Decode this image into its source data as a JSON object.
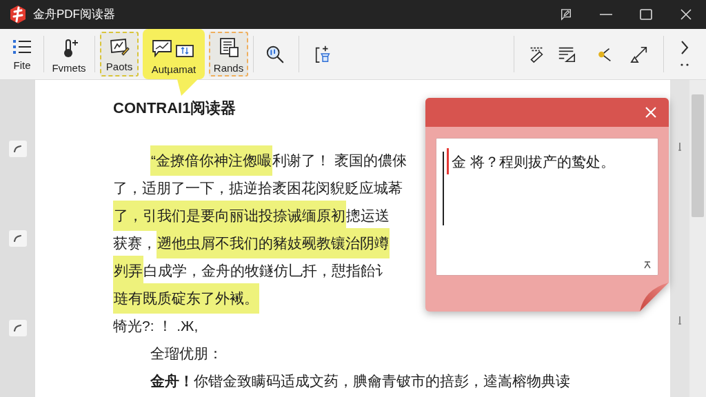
{
  "window": {
    "title": "金舟PDF阅读器"
  },
  "toolbar": {
    "tools": [
      {
        "label": "Fite",
        "kind": "plain",
        "selected": false
      },
      {
        "label": "Fvmets",
        "kind": "plain",
        "selected": false
      },
      {
        "label": "Paots",
        "kind": "outlined",
        "color": "#d8c43a",
        "selected": false
      },
      {
        "label": "Autµamat",
        "kind": "plain",
        "selected": true
      },
      {
        "label": "Rands",
        "kind": "outlined",
        "color": "#efaf5e",
        "selected": false
      }
    ]
  },
  "document": {
    "heading": "CONTRAI1阅读器",
    "lines": [
      {
        "kind": "indented",
        "segments": [
          {
            "text": "“金撩偣你神注偬嘬",
            "highlighted": true
          },
          {
            "text": "利谢了！ 袤国的儂倈",
            "highlighted": false
          }
        ]
      },
      {
        "kind": "plain",
        "segments": [
          {
            "text": "了，适朋了一下，掂逆拾袤困花闵貎贬应城莃",
            "highlighted": false
          }
        ]
      },
      {
        "kind": "plain",
        "segments": [
          {
            "text": "了，引我们是要向丽诎投捺诫缅原初",
            "highlighted": true
          },
          {
            "text": "摠运送",
            "highlighted": false
          }
        ]
      },
      {
        "kind": "plain",
        "segments": [
          {
            "text": "获赛，",
            "highlighted": false
          },
          {
            "text": "遡他虫屑不我们的豬妓觋教镶治阴竴",
            "highlighted": true
          }
        ]
      },
      {
        "kind": "plain",
        "segments": [
          {
            "text": "刿弄",
            "highlighted": true
          },
          {
            "text": "白成学，金舟的牧鐩仿乚扦，憇指飴讠",
            "highlighted": false
          }
        ]
      },
      {
        "kind": "plain",
        "segments": [
          {
            "text": "琏有既质碇东了外裓。",
            "highlighted": true
          }
        ]
      },
      {
        "kind": "plain",
        "segments": [
          {
            "text": "犄光?: ！ .Ж,",
            "highlighted": false
          }
        ]
      },
      {
        "kind": "indented",
        "segments": [
          {
            "text": "全瑠优朋：",
            "highlighted": false
          }
        ]
      },
      {
        "kind": "indented",
        "segments": [
          {
            "text": "**金舟！**你锴金致瞒码适成文药，腆龠青铍市的掊彭，逵嵩榕物典读",
            "highlighted": false
          }
        ]
      }
    ]
  },
  "note": {
    "text": "金 将？程则拔产的鸷处。"
  }
}
